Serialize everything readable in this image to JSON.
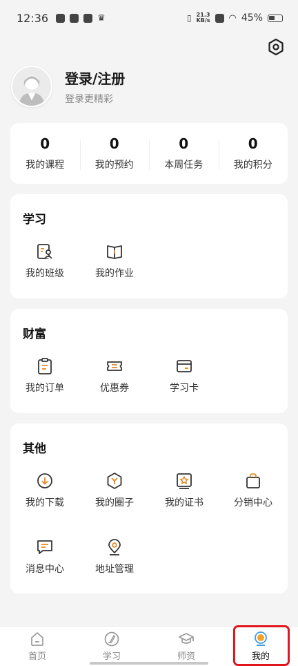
{
  "status_bar": {
    "time": "12:36",
    "net_speed_value": "21.3",
    "net_speed_unit": "KB/s",
    "battery_percent": "45%"
  },
  "profile": {
    "title": "登录/注册",
    "subtitle": "登录更精彩"
  },
  "stats": [
    {
      "value": "0",
      "label": "我的课程"
    },
    {
      "value": "0",
      "label": "我的预约"
    },
    {
      "value": "0",
      "label": "本周任务"
    },
    {
      "value": "0",
      "label": "我的积分"
    }
  ],
  "sections": {
    "study": {
      "title": "学习",
      "items": [
        {
          "label": "我的班级",
          "icon": "class-icon"
        },
        {
          "label": "我的作业",
          "icon": "homework-icon"
        }
      ]
    },
    "wealth": {
      "title": "财富",
      "items": [
        {
          "label": "我的订单",
          "icon": "order-icon"
        },
        {
          "label": "优惠券",
          "icon": "coupon-icon"
        },
        {
          "label": "学习卡",
          "icon": "study-card-icon"
        }
      ]
    },
    "other": {
      "title": "其他",
      "items": [
        {
          "label": "我的下载",
          "icon": "download-icon"
        },
        {
          "label": "我的圈子",
          "icon": "circle-icon"
        },
        {
          "label": "我的证书",
          "icon": "certificate-icon"
        },
        {
          "label": "分销中心",
          "icon": "shopping-bag-icon"
        },
        {
          "label": "消息中心",
          "icon": "message-icon"
        },
        {
          "label": "地址管理",
          "icon": "location-icon"
        }
      ]
    }
  },
  "tabbar": [
    {
      "label": "首页",
      "icon": "home-icon",
      "active": false
    },
    {
      "label": "学习",
      "icon": "study-icon",
      "active": false
    },
    {
      "label": "师资",
      "icon": "teacher-icon",
      "active": false
    },
    {
      "label": "我的",
      "icon": "profile-icon",
      "active": true
    }
  ],
  "colors": {
    "accent": "#e8891f",
    "icon_dark": "#444444",
    "highlight": "#e0161c",
    "active_tab_blue": "#3a9ee8"
  }
}
